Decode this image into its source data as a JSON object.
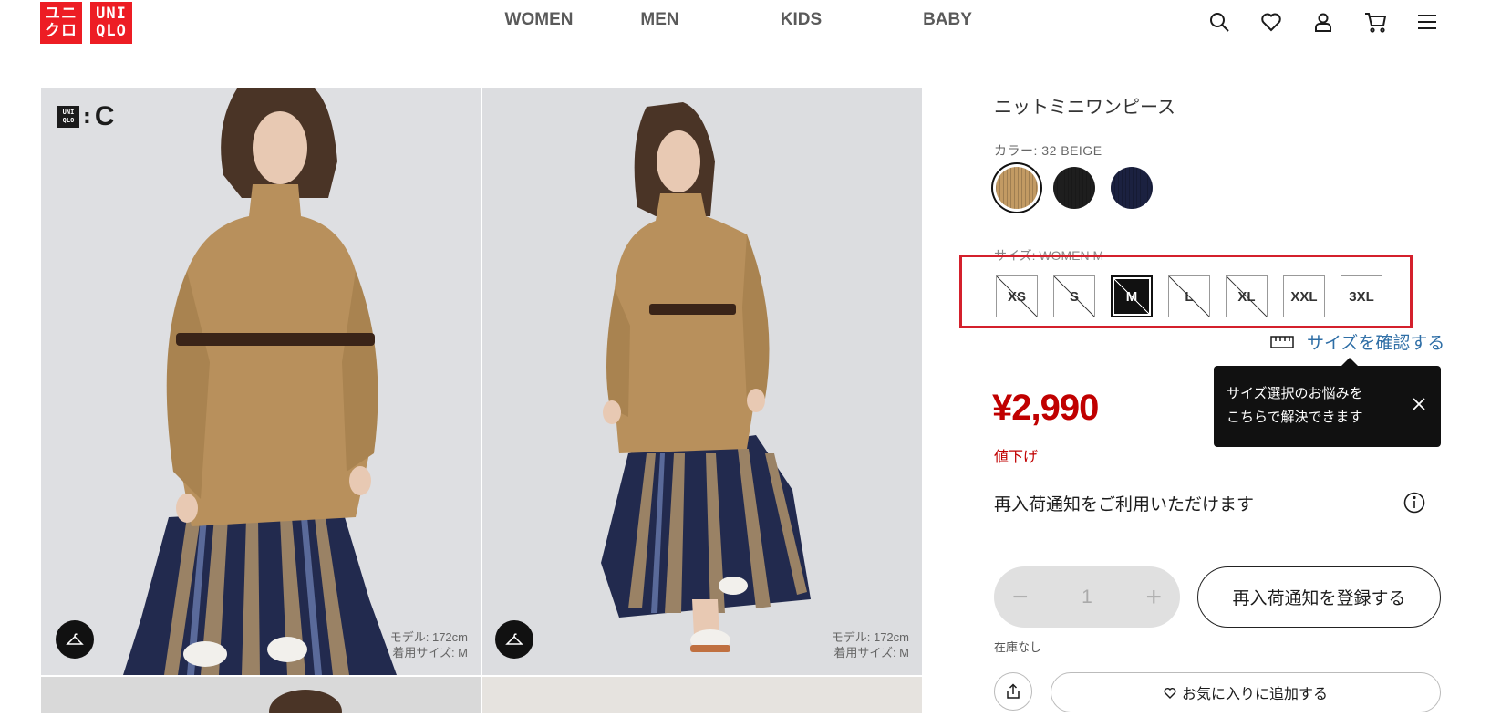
{
  "logo": {
    "box1": [
      "ユニ",
      "クロ"
    ],
    "box2": [
      "UNI",
      "QLO"
    ]
  },
  "nav": {
    "items": [
      "WOMEN",
      "MEN",
      "KIDS",
      "BABY"
    ]
  },
  "header_icons": [
    "search-icon",
    "heart-icon",
    "account-icon",
    "cart-icon",
    "menu-icon"
  ],
  "images": [
    {
      "model_height": "モデル: 172cm",
      "model_size": "着用サイズ: M",
      "brand_mini": [
        "UNI",
        "QLO"
      ],
      "brand_c": "C"
    },
    {
      "model_height": "モデル: 172cm",
      "model_size": "着用サイズ: M"
    }
  ],
  "product": {
    "title": "ニットミニワンピース",
    "color_label": "カラー: 32 BEIGE",
    "colors": [
      {
        "name": "beige",
        "hex": "#c29a63",
        "selected": true
      },
      {
        "name": "black",
        "hex": "#1e1e1e",
        "selected": false
      },
      {
        "name": "navy",
        "hex": "#1b2140",
        "selected": false
      }
    ],
    "size_label": "サイズ: WOMEN M",
    "sizes": [
      {
        "label": "XS",
        "available": false,
        "selected": false
      },
      {
        "label": "S",
        "available": false,
        "selected": false
      },
      {
        "label": "M",
        "available": false,
        "selected": true
      },
      {
        "label": "L",
        "available": false,
        "selected": false
      },
      {
        "label": "XL",
        "available": false,
        "selected": false
      },
      {
        "label": "XXL",
        "available": true,
        "selected": false
      },
      {
        "label": "3XL",
        "available": true,
        "selected": false
      }
    ],
    "size_check_link": "サイズを確認する",
    "tooltip": {
      "line1": "サイズ選択のお悩みを",
      "line2": "こちらで解決できます"
    },
    "price": "¥2,990",
    "price_note": "値下げ",
    "restock_text": "再入荷通知をご利用いただけます",
    "quantity": "1",
    "qty_minus": "−",
    "qty_plus": "+",
    "restock_button": "再入荷通知を登録する",
    "stock_status": "在庫なし",
    "favorite_button": "お気に入りに追加する"
  },
  "colors": {
    "brand_red": "#ed1d24",
    "price_red": "#c00000",
    "highlight_frame": "#d4202c",
    "link_blue": "#2e6ea6"
  }
}
